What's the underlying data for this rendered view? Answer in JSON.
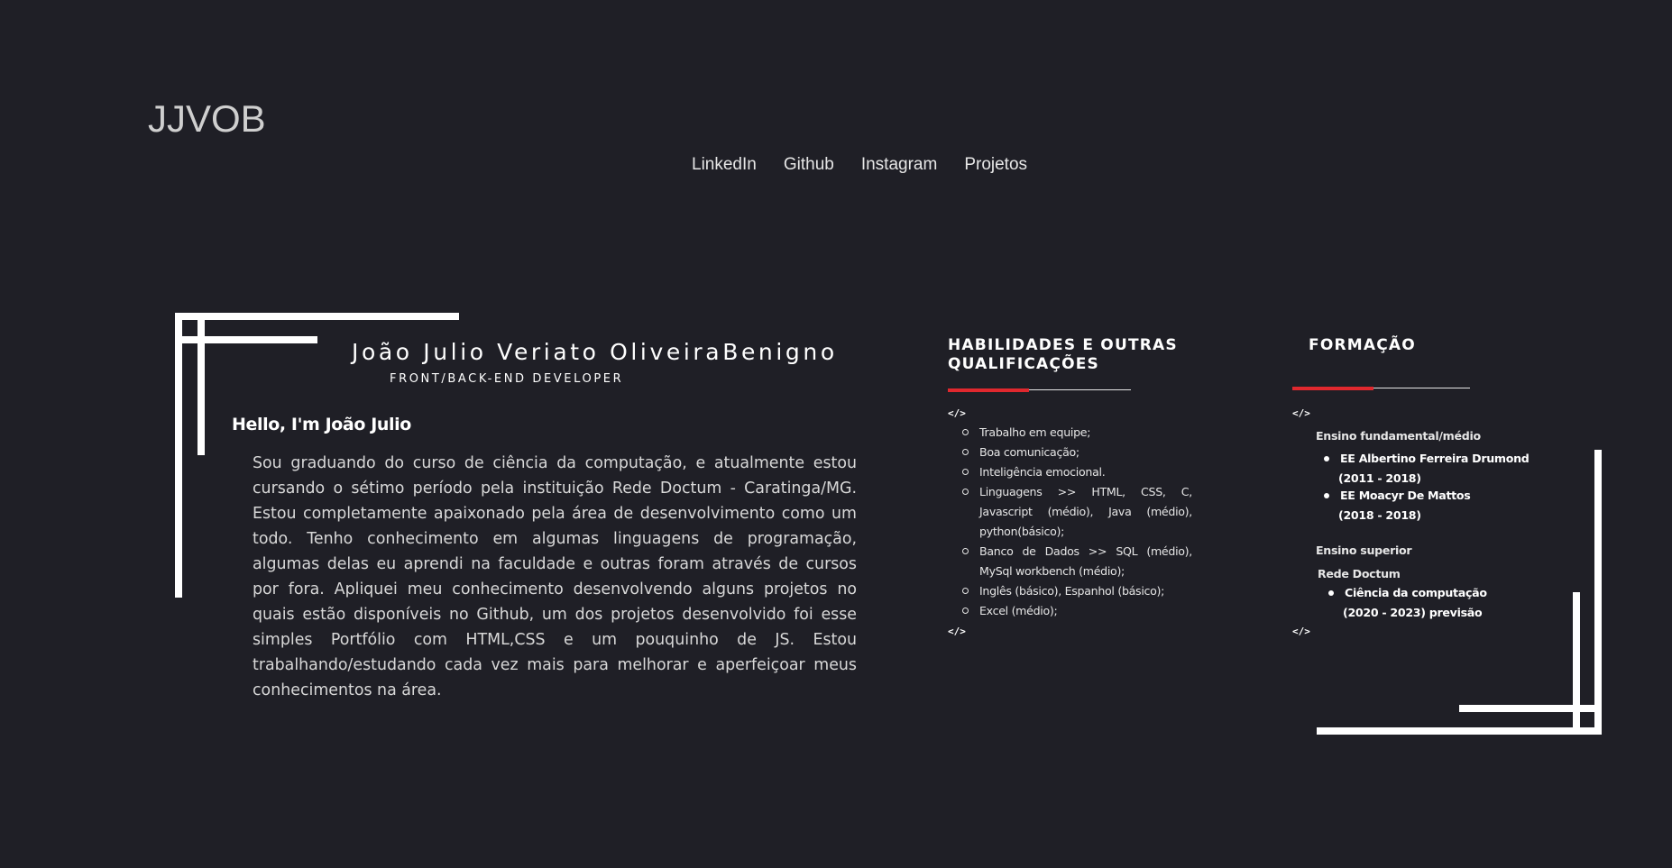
{
  "header": {
    "logo": "JJVOB",
    "nav": [
      "LinkedIn",
      "Github",
      "Instagram",
      "Projetos"
    ]
  },
  "profile": {
    "name": "João Julio Veriato OliveiraBenigno",
    "role": "FRONT/BACK-END DEVELOPER",
    "greeting": "Hello, I'm João Julio",
    "bio": "Sou graduando do curso de ciência da computação, e atualmente estou cursando o sétimo período pela instituição Rede Doctum - Caratinga/MG. Estou completamente apaixonado pela área de desenvolvimento como um todo. Tenho conhecimento em algumas linguagens de programação, algumas delas eu aprendi na faculdade e outras foram através de cursos por fora.  Apliquei meu conhecimento desenvolvendo alguns projetos no quais estão disponíveis no Github, um dos projetos desenvolvido foi esse simples Portfólio com HTML,CSS e um pouquinho de JS. Estou trabalhando/estudando cada vez mais para melhorar e aperfeiçoar meus conhecimentos na área."
  },
  "skills": {
    "title_line1": "HABILIDADES E OUTRAS",
    "title_line2": "QUALIFICAÇÕES",
    "open_tag": "</>",
    "close_tag": "</>",
    "items": [
      "Trabalho em equipe;",
      "Boa comunicação;",
      "Inteligência emocional.",
      "Linguagens >> HTML, CSS, C, Javascript (médio), Java (médio), python(básico);",
      "Banco de Dados >> SQL (médio), MySql workbench (médio);",
      "Inglês (básico), Espanhol (básico);",
      "Excel (médio);"
    ]
  },
  "education": {
    "title": "FORMAÇÃO",
    "open_tag": "</>",
    "close_tag": "</>",
    "basic_heading": "Ensino fundamental/médio",
    "basic_schools": [
      {
        "name": "EE Albertino Ferreira Drumond",
        "period": "(2011 - 2018)"
      },
      {
        "name": "EE Moacyr De Mattos",
        "period": "(2018 - 2018)"
      }
    ],
    "higher_heading": "Ensino superior",
    "higher_institution": "Rede Doctum",
    "higher_course": "Ciência da computação",
    "higher_period": "(2020 - 2023) previsão"
  },
  "colors": {
    "background": "#1f1f26",
    "accent": "#e0282e",
    "frame": "#ffffff"
  }
}
